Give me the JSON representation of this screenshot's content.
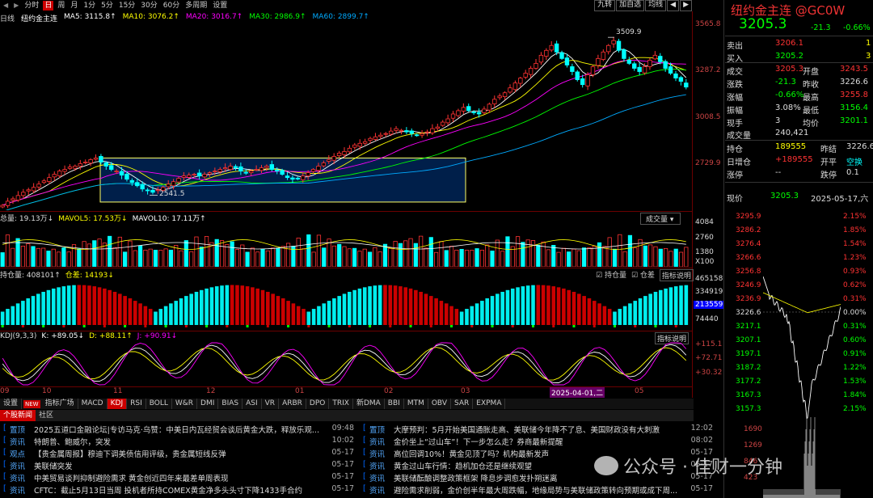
{
  "toolbar": {
    "nav_left": "◀",
    "nav_right": "▶",
    "periods": [
      {
        "label": "分时"
      },
      {
        "label": "日",
        "active": true
      },
      {
        "label": "周"
      },
      {
        "label": "月"
      },
      {
        "label": "1分"
      },
      {
        "label": "5分"
      },
      {
        "label": "15分"
      },
      {
        "label": "30分"
      },
      {
        "label": "60分"
      },
      {
        "label": "多周期"
      },
      {
        "label": "设置"
      }
    ],
    "right": [
      "九转",
      "加自选",
      "均线",
      "◀",
      "▶"
    ]
  },
  "ma": {
    "label": "日线",
    "name": "纽约金主连",
    "ma5": "MA5: 3115.8↑",
    "ma10": "MA10: 3076.2↑",
    "ma20": "MA20: 3016.7↑",
    "ma30": "MA30: 2986.9↑",
    "ma60": "MA60: 2899.7↑"
  },
  "main_axis": [
    "3565.8",
    "3287.2",
    "3008.5",
    "2729.9"
  ],
  "annotations": {
    "high": "3509.9",
    "low": "2541.5"
  },
  "vol": {
    "hdr": "总量: 19.13万↓",
    "mavol5": "MAVOL5: 17.53万↓",
    "mavol10": "MAVOL10: 17.11万↑",
    "btn": "成交量",
    "axis": [
      "4084",
      "2760",
      "1380",
      "X100"
    ]
  },
  "oi": {
    "hdr": "持仓量: 408101↑",
    "diff": "仓差: 14193↓",
    "chk1": "持仓量",
    "chk2": "仓差",
    "btn": "指标说明",
    "axis": [
      "465158",
      "334919",
      "213559",
      "74440"
    ]
  },
  "kdj": {
    "hdr": "KDJ(9,3,3)",
    "k": "K: +89.05↓",
    "d": "D: +88.11↑",
    "j": "J: +90.91↓",
    "btn": "指标说明",
    "axis": [
      "+115.1",
      "+72.71",
      "+30.32"
    ]
  },
  "xaxis": [
    "09",
    "10",
    "11",
    "12",
    "01",
    "02",
    "03",
    "2025-04-01,二",
    "05"
  ],
  "indicators": {
    "settings": "设置",
    "new": "NEW",
    "plaza": "指标广场",
    "tabs": [
      {
        "label": "MACD"
      },
      {
        "label": "KDJ",
        "active": true
      },
      {
        "label": "RSI"
      },
      {
        "label": "BOLL"
      },
      {
        "label": "W&R"
      },
      {
        "label": "DMI"
      },
      {
        "label": "BIAS"
      },
      {
        "label": "ASI"
      },
      {
        "label": "VR"
      },
      {
        "label": "ARBR"
      },
      {
        "label": "DPO"
      },
      {
        "label": "TRIX"
      },
      {
        "label": "新DMA"
      },
      {
        "label": "BBI"
      },
      {
        "label": "MTM"
      },
      {
        "label": "OBV"
      },
      {
        "label": "SAR"
      },
      {
        "label": "EXPMA"
      }
    ]
  },
  "news_tabs": [
    {
      "label": "个股新闻",
      "active": true
    },
    {
      "label": "社区"
    }
  ],
  "news_left": [
    {
      "cat": "置顶",
      "title": "2025五道口金融论坛|专访马克·乌赞：中美日内瓦经贸会谈后黄金大跌，释放乐观...",
      "time": "09:48"
    },
    {
      "cat": "资讯",
      "title": "特朗普、鲍威尔，突发",
      "time": "10:02"
    },
    {
      "cat": "观点",
      "title": "【贵金属周报】穆迪下调美债信用评级，贵金属短线反弹",
      "time": "05-17"
    },
    {
      "cat": "资讯",
      "title": "美联储突发",
      "time": "05-17"
    },
    {
      "cat": "资讯",
      "title": "中美贸易谈判抑制避险需求 黄金创近四年来最差单周表现",
      "time": "05-17"
    },
    {
      "cat": "资讯",
      "title": "CFTC：截止5月13日当周 投机者所持COMEX黄金净多头头寸下降1433手合约",
      "time": "05-17"
    }
  ],
  "news_right": [
    {
      "cat": "置顶",
      "title": "大摩预判：5月开始美国通胀走高、美联储今年降不了息、美国财政没有大刺激",
      "time": "12:02"
    },
    {
      "cat": "资讯",
      "title": "金价坐上“过山车”！下一步怎么走？券商最新提醒",
      "time": "08:02"
    },
    {
      "cat": "资讯",
      "title": "高位回调10%！黄金见顶了吗？机构最新发声",
      "time": "05-17"
    },
    {
      "cat": "资讯",
      "title": "黄金过山车行情：趋机加仓还是继续观望",
      "time": "05-17"
    },
    {
      "cat": "资讯",
      "title": "美联储酝酿调整政策框架 降息步调愈发扑朔迷离",
      "time": "05-17"
    },
    {
      "cat": "资讯",
      "title": "避险需求削弱，金价创半年最大周跌幅，地缘局势与美联储政策转向预期或成下周...",
      "time": "05-17"
    }
  ],
  "quote": {
    "title": "纽约金主连 @GC0W",
    "price": "3205.3",
    "chg": "-21.3",
    "pct": "-0.66%",
    "sell": {
      "label": "卖出",
      "price": "3206.1",
      "vol": "1"
    },
    "buy": {
      "label": "买入",
      "price": "3205.2",
      "vol": "3"
    },
    "rows": [
      {
        "l1": "成交",
        "v1": "3205.3",
        "l2": "开盘",
        "v2": "3243.5",
        "c1": "red",
        "c2": "red"
      },
      {
        "l1": "涨跌",
        "v1": "-21.3",
        "l2": "昨收",
        "v2": "3226.6",
        "c1": "grn",
        "c2": "wht"
      },
      {
        "l1": "涨幅",
        "v1": "-0.66%",
        "l2": "最高",
        "v2": "3255.8",
        "c1": "grn",
        "c2": "red"
      },
      {
        "l1": "振幅",
        "v1": "3.08%",
        "l2": "最低",
        "v2": "3156.4",
        "c1": "wht",
        "c2": "grn"
      },
      {
        "l1": "现手",
        "v1": "3",
        "l2": "均价",
        "v2": "3201.1",
        "c1": "wht",
        "c2": "grn"
      }
    ],
    "volume": {
      "label": "成交量",
      "value": "240,421"
    },
    "oi_rows": [
      {
        "l1": "持仓",
        "v1": "189555",
        "l2": "昨结",
        "v2": "3226.6"
      },
      {
        "l1": "日增仓",
        "v1": "+189555",
        "l2": "开平",
        "v2": "空换"
      },
      {
        "l1": "涨停",
        "v1": "--",
        "l2": "跌停",
        "v2": "0.1"
      }
    ],
    "now_label": "现价",
    "now_price": "3205.3",
    "date": "2025-05-17,六",
    "mini_left": [
      "3295.9",
      "3286.2",
      "3276.4",
      "3266.6",
      "3256.8",
      "3246.9",
      "3236.9",
      "3226.6",
      "3217.1",
      "3207.1",
      "3197.1",
      "3187.2",
      "3177.2",
      "3167.3",
      "3157.3"
    ],
    "mini_right": [
      "2.15%",
      "1.85%",
      "1.54%",
      "1.23%",
      "0.93%",
      "0.62%",
      "0.31%",
      "0.00%",
      "0.31%",
      "0.60%",
      "0.91%",
      "1.22%",
      "1.53%",
      "1.84%",
      "2.15%"
    ],
    "mini_vol": [
      "1690",
      "1269",
      "846",
      "423"
    ]
  },
  "watermark": "公众号 · 佳财一分钟",
  "chart_data": {
    "type": "candlestick",
    "title": "纽约金主连",
    "ylim": [
      2450,
      3600
    ],
    "high_label": 3509.9,
    "low_label": 2541.5,
    "ma": {
      "ma5": 3115.8,
      "ma10": 3076.2,
      "ma20": 3016.7,
      "ma30": 2986.9,
      "ma60": 2899.7
    },
    "close_path": [
      2480,
      2505,
      2520,
      2540,
      2560,
      2575,
      2590,
      2610,
      2630,
      2650,
      2670,
      2690,
      2700,
      2715,
      2720,
      2735,
      2745,
      2760,
      2770,
      2745,
      2720,
      2700,
      2690,
      2665,
      2640,
      2620,
      2600,
      2580,
      2570,
      2560,
      2575,
      2590,
      2610,
      2625,
      2645,
      2660,
      2665,
      2670,
      2660,
      2670,
      2680,
      2690,
      2700,
      2710,
      2720,
      2710,
      2690,
      2680,
      2690,
      2700,
      2710,
      2720,
      2700,
      2690,
      2670,
      2650,
      2640,
      2645,
      2660,
      2680,
      2700,
      2720,
      2740,
      2760,
      2780,
      2800,
      2810,
      2830,
      2850,
      2860,
      2870,
      2890,
      2900,
      2910,
      2920,
      2935,
      2950,
      2940,
      2930,
      2920,
      2910,
      2920,
      2930,
      2950,
      2960,
      2990,
      3010,
      3040,
      3060,
      3080,
      3060,
      3050,
      3040,
      3070,
      3100,
      3130,
      3150,
      3170,
      3200,
      3230,
      3260,
      3290,
      3320,
      3350,
      3400,
      3430,
      3460,
      3420,
      3380,
      3340,
      3300,
      3250,
      3220,
      3280,
      3330,
      3380,
      3420,
      3460,
      3490,
      3430,
      3380,
      3350,
      3320,
      3300,
      3330,
      3370,
      3400,
      3360,
      3320,
      3290,
      3260,
      3240,
      3205
    ]
  }
}
